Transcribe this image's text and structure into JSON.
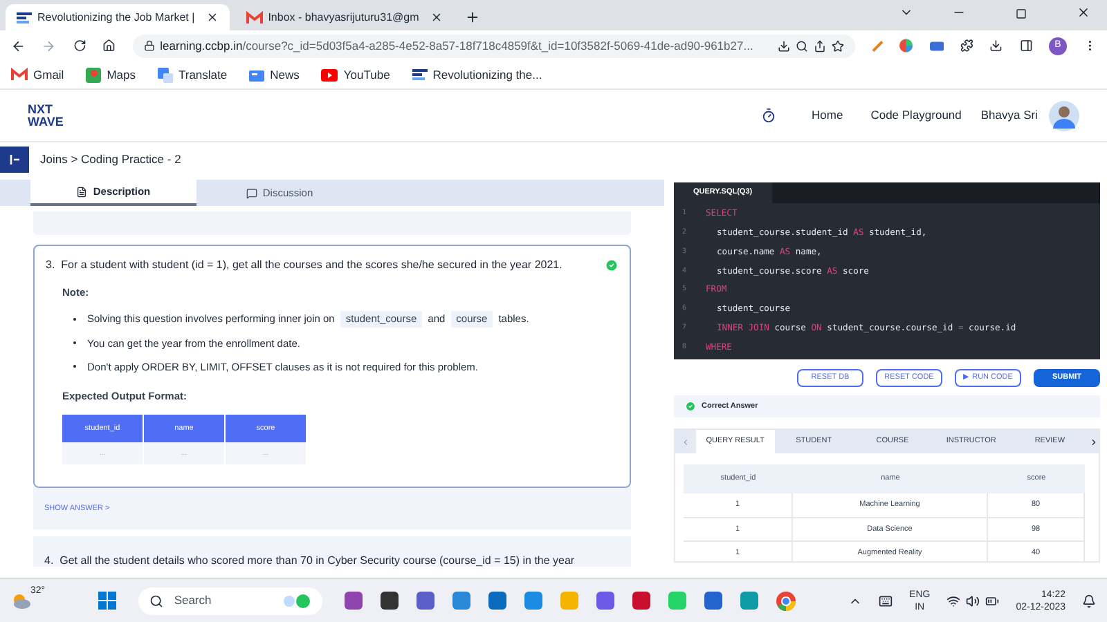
{
  "browser": {
    "tabs": [
      {
        "title": "Revolutionizing the Job Market |",
        "selected": true
      },
      {
        "title": "Inbox - bhavyasrijuturu31@gm",
        "selected": false
      }
    ],
    "url_host": "learning.ccbp.in",
    "url_path": "/course?c_id=5d03f5a4-a285-4e52-8a57-18f718c4859f&t_id=10f3582f-5069-41de-ad90-961b27...",
    "profile": "B",
    "bookmarks": [
      "Gmail",
      "Maps",
      "Translate",
      "News",
      "YouTube",
      "Revolutionizing the..."
    ]
  },
  "header": {
    "logo_top": "NXT",
    "logo_bottom": "WAVE",
    "nav": [
      "Home",
      "Code Playground"
    ],
    "user": "Bhavya Sri"
  },
  "breadcrumb": "Joins > Coding Practice - 2",
  "tabs": [
    {
      "label": "Description",
      "selected": true
    },
    {
      "label": "Discussion",
      "selected": false
    }
  ],
  "question": {
    "number": "3.",
    "text": "For a student with student (id = 1), get all the courses and the scores she/he secured in the year 2021.",
    "solved": true,
    "note_title": "Note:",
    "bullets": [
      [
        {
          "kind": "text",
          "text": "Solving this question involves performing inner join on"
        },
        {
          "kind": "code",
          "text": "student_course"
        },
        {
          "kind": "text",
          "text": "and"
        },
        {
          "kind": "code",
          "text": "course"
        },
        {
          "kind": "text",
          "text": "tables."
        }
      ],
      [
        {
          "kind": "text",
          "text": "You can get the year from the enrollment date."
        }
      ],
      [
        {
          "kind": "text",
          "text": "Don't apply ORDER BY, LIMIT, OFFSET clauses as it is not required for this problem."
        }
      ]
    ],
    "output_title": "Expected Output Format:",
    "output_columns": [
      "student_id",
      "name",
      "score"
    ],
    "output_row": [
      "...",
      "...",
      "..."
    ]
  },
  "show_answer": "SHOW ANSWER >",
  "next_question": {
    "number": "4.",
    "text": "Get all the student details who scored more than 70 in Cyber Security course (course_id = 15) in the year"
  },
  "editor": {
    "file": "QUERY.SQL(Q3)",
    "lines": [
      {
        "number": "1",
        "nested": false,
        "tokens": [
          {
            "kind": "keyword",
            "text": "SELECT"
          }
        ]
      },
      {
        "number": "2",
        "nested": true,
        "tokens": [
          {
            "kind": "plain",
            "text": "student_course.student_id"
          },
          {
            "kind": "keyword",
            "text": "AS"
          },
          {
            "kind": "plain",
            "text": "student_id,"
          }
        ]
      },
      {
        "number": "3",
        "nested": true,
        "tokens": [
          {
            "kind": "plain",
            "text": "course.name"
          },
          {
            "kind": "keyword",
            "text": "AS"
          },
          {
            "kind": "plain",
            "text": "name,"
          }
        ]
      },
      {
        "number": "4",
        "nested": true,
        "tokens": [
          {
            "kind": "plain",
            "text": "student_course.score"
          },
          {
            "kind": "keyword",
            "text": "AS"
          },
          {
            "kind": "plain",
            "text": "score"
          }
        ]
      },
      {
        "number": "5",
        "nested": false,
        "tokens": [
          {
            "kind": "keyword",
            "text": "FROM"
          }
        ]
      },
      {
        "number": "6",
        "nested": true,
        "tokens": [
          {
            "kind": "plain",
            "text": "student_course"
          }
        ]
      },
      {
        "number": "7",
        "nested": true,
        "tokens": [
          {
            "kind": "keyword",
            "text": "INNER JOIN"
          },
          {
            "kind": "plain",
            "text": "course"
          },
          {
            "kind": "keyword",
            "text": "ON"
          },
          {
            "kind": "plain",
            "text": "student_course.course_id"
          },
          {
            "kind": "operator",
            "text": "="
          },
          {
            "kind": "plain",
            "text": "course.id"
          }
        ]
      },
      {
        "number": "8",
        "nested": false,
        "tokens": [
          {
            "kind": "keyword",
            "text": "WHERE"
          }
        ]
      }
    ]
  },
  "actions": [
    {
      "label": "RESET DB",
      "kind": "outline"
    },
    {
      "label": "RESET CODE",
      "kind": "outline"
    },
    {
      "label": "▶ RUN CODE",
      "kind": "outline"
    },
    {
      "label": "SUBMIT",
      "kind": "primary"
    }
  ],
  "result_status": "Correct Answer",
  "result_tabs": [
    {
      "label": "QUERY RESULT",
      "selected": true
    },
    {
      "label": "STUDENT",
      "selected": false
    },
    {
      "label": "COURSE",
      "selected": false
    },
    {
      "label": "INSTRUCTOR",
      "selected": false
    },
    {
      "label": "REVIEW",
      "selected": false
    }
  ],
  "result_table": {
    "columns": [
      "student_id",
      "name",
      "score"
    ],
    "rows": [
      [
        "1",
        "Machine Learning",
        "80"
      ],
      [
        "1",
        "Data Science",
        "98"
      ],
      [
        "1",
        "Augmented Reality",
        "40"
      ]
    ]
  },
  "taskbar": {
    "weather": "32°",
    "search_placeholder": "Search",
    "language": "ENG",
    "region": "IN",
    "time": "14:22",
    "date": "02-12-2023"
  }
}
